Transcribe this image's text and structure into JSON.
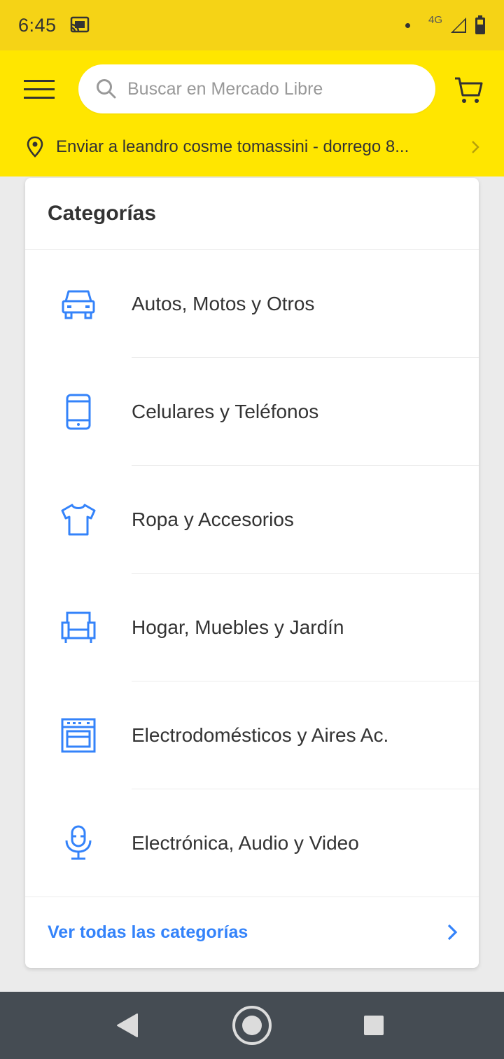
{
  "status_bar": {
    "time": "6:45",
    "network": "4G",
    "icons": [
      "cast-icon",
      "signal-icon",
      "battery-icon"
    ]
  },
  "header": {
    "menu_icon": "hamburger-menu-icon",
    "search": {
      "placeholder": "Buscar en Mercado Libre",
      "value": ""
    },
    "cart_icon": "cart-icon",
    "address": "Enviar a leandro cosme tomassini - dorrego 8..."
  },
  "categories": {
    "title": "Categorías",
    "items": [
      {
        "label": "Autos, Motos y Otros",
        "icon": "car-icon"
      },
      {
        "label": "Celulares y Teléfonos",
        "icon": "phone-icon"
      },
      {
        "label": "Ropa y Accesorios",
        "icon": "shirt-icon"
      },
      {
        "label": "Hogar, Muebles y Jardín",
        "icon": "armchair-icon"
      },
      {
        "label": "Electrodomésticos y Aires Ac.",
        "icon": "appliance-icon"
      },
      {
        "label": "Electrónica, Audio y Video",
        "icon": "microphone-icon"
      }
    ],
    "see_all": "Ver todas las categorías"
  },
  "colors": {
    "header_yellow": "#ffe600",
    "status_yellow": "#f5d316",
    "accent_blue": "#3483fa",
    "icon_blue": "#3483fa",
    "nav_bar": "#454c53"
  }
}
